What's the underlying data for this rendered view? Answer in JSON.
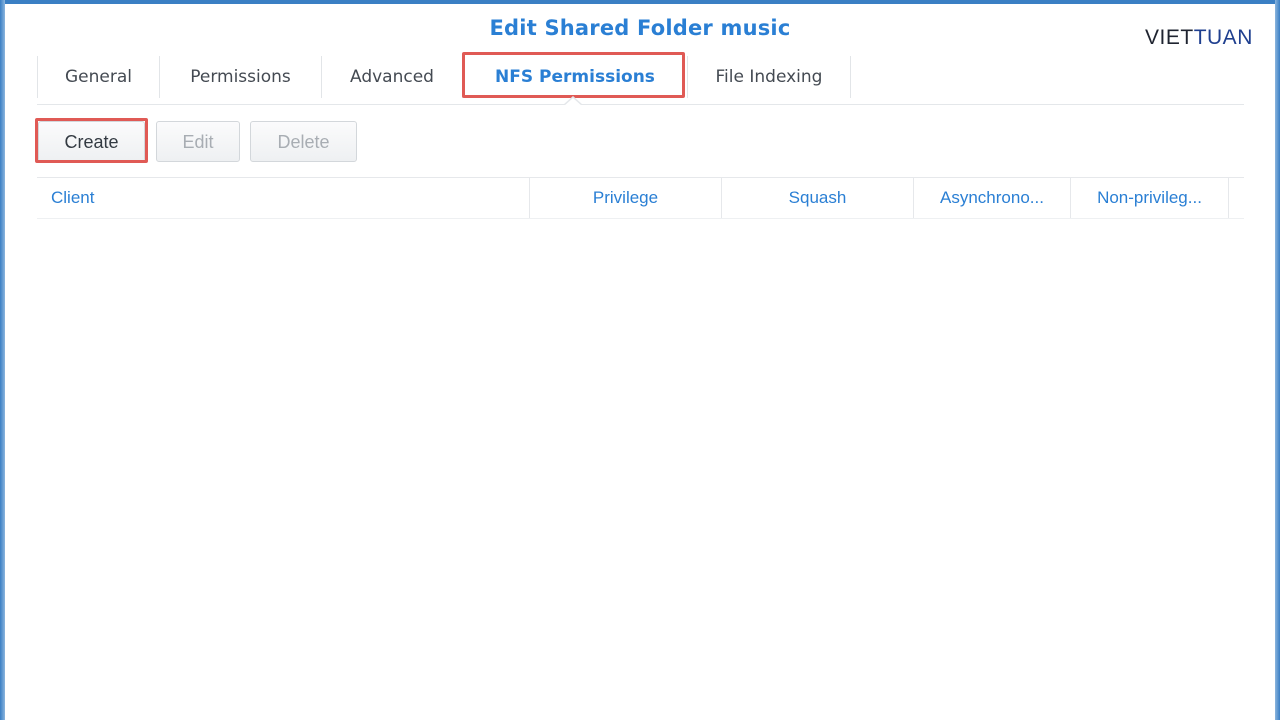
{
  "window": {
    "title": "Edit Shared Folder music"
  },
  "brand": {
    "part1": "VIET",
    "part2": "TUAN"
  },
  "tabs": [
    {
      "label": "General",
      "active": false
    },
    {
      "label": "Permissions",
      "active": false
    },
    {
      "label": "Advanced",
      "active": false
    },
    {
      "label": "NFS Permissions",
      "active": true
    },
    {
      "label": "File Indexing",
      "active": false
    }
  ],
  "toolbar": {
    "create_label": "Create",
    "edit_label": "Edit",
    "delete_label": "Delete"
  },
  "grid": {
    "columns": [
      "Client",
      "Privilege",
      "Squash",
      "Asynchrono...",
      "Non-privileg..."
    ],
    "rows": []
  },
  "colors": {
    "accent": "#2a7fd4",
    "highlight": "#e05a55"
  }
}
